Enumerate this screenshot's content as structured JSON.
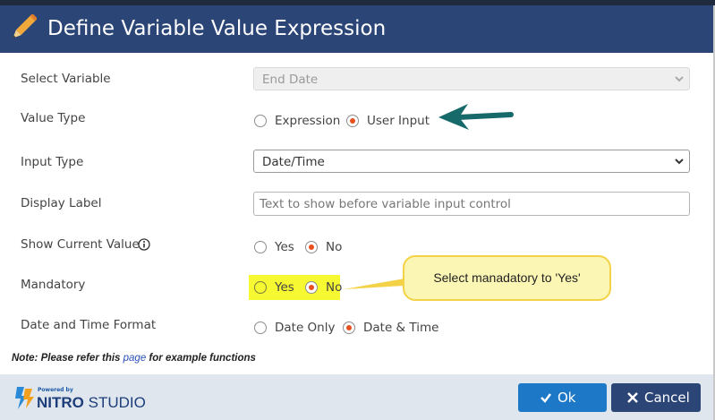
{
  "dialog": {
    "title": "Define Variable Value Expression",
    "icon": "pencil-icon",
    "header_color": "#2b4577",
    "accent_color": "#e8501d"
  },
  "form": {
    "select_variable": {
      "label": "Select Variable",
      "value": "End Date",
      "disabled": true
    },
    "value_type": {
      "label": "Value Type",
      "options": [
        "Expression",
        "User Input"
      ],
      "selected": "User Input"
    },
    "input_type": {
      "label": "Input Type",
      "value": "Date/Time"
    },
    "display_label": {
      "label": "Display Label",
      "value": "",
      "placeholder": "Text to show before variable input control"
    },
    "show_current_value": {
      "label": "Show Current Value",
      "options": [
        "Yes",
        "No"
      ],
      "selected": "No",
      "info_icon": "info-icon"
    },
    "mandatory": {
      "label": "Mandatory",
      "options": [
        "Yes",
        "No"
      ],
      "selected": "No"
    },
    "date_time_format": {
      "label": "Date and Time Format",
      "options": [
        "Date Only",
        "Date & Time"
      ],
      "selected": "Date & Time"
    }
  },
  "callout": {
    "text": "Select manadatory to 'Yes'"
  },
  "note": {
    "prefix": "Note: Please refer this ",
    "link": "page",
    "suffix": " for example functions"
  },
  "footer": {
    "logo_small": "Powered by",
    "logo_main": "NITRO",
    "logo_sub": "STUDIO",
    "ok_label": "Ok",
    "cancel_label": "Cancel"
  }
}
